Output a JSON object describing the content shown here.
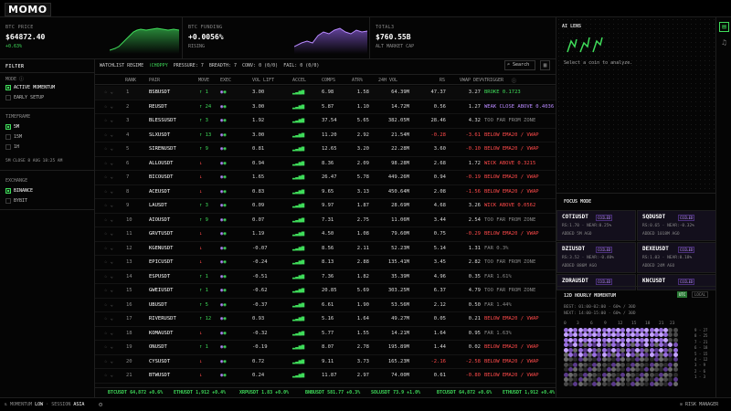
{
  "app": {
    "logo": "MOMO"
  },
  "metrics": [
    {
      "label": "BTC PRICE",
      "value": "$64872.40",
      "sub": "+0.63%",
      "sub_color": "g"
    },
    {
      "label": "BTC FUNDING",
      "value": "+0.0056%",
      "sub": "RISING",
      "sub_color": "m"
    },
    {
      "label": "TOTAL3",
      "value": "$760.55B",
      "sub": "ALT MARKET CAP",
      "sub_color": "m"
    }
  ],
  "sidebar": {
    "filter": "FILTER",
    "mode": "MODE",
    "mode_opts": [
      "ACTIVE MOMENTUM",
      "EARLY SETUP"
    ],
    "timeframe": "TIMEFRAME",
    "tf_opts": [
      "5M",
      "15M",
      "1H"
    ],
    "close_note": "5M CLOSE 8 AUG 18:25 AM",
    "exchange": "EXCHANGE",
    "ex_opts": [
      "BINANCE",
      "BYBIT"
    ]
  },
  "regime": {
    "label": "WATCHLIST REGIME",
    "value": "CHOPPY",
    "pressure": "PRESSURE: 7",
    "breadth": "BREADTH: 7",
    "conv": "CONV: 0 (0/0)",
    "fail": "FAIL: 0 (0/0)"
  },
  "search": {
    "label": "Search"
  },
  "columns": [
    "RANK",
    "PAIR",
    "MOVE",
    "EXEC",
    "VOL LIFT",
    "ACCEL",
    "COMPS",
    "ATR%",
    "24H VOL",
    "RS",
    "VWAP DEV%",
    "TRIGGER"
  ],
  "rows": [
    {
      "rank": "1",
      "pair": "BSBUSDT",
      "move": "↑ 1",
      "mc": "g",
      "lift": "3.00",
      "comps": "6.98",
      "atr": "1.58",
      "vol": "64.39M",
      "rs": "47.37",
      "rsc": "",
      "vw": "3.27",
      "vwc": "",
      "trig": "BROKE 0.1723",
      "tc": "g"
    },
    {
      "rank": "2",
      "pair": "REUSDT",
      "move": "↑ 24",
      "mc": "g",
      "lift": "3.00",
      "comps": "5.87",
      "atr": "1.10",
      "vol": "14.72M",
      "rs": "0.56",
      "rsc": "",
      "vw": "1.27",
      "vwc": "",
      "trig": "WEAK CLOSE ABOVE 0.4036",
      "tc": "p"
    },
    {
      "rank": "3",
      "pair": "BLESSUSDT",
      "move": "↑ 3",
      "mc": "g",
      "lift": "1.92",
      "comps": "37.54",
      "atr": "5.65",
      "vol": "382.05M",
      "rs": "28.46",
      "rsc": "",
      "vw": "4.32",
      "vwc": "",
      "trig": "TOO FAR FROM ZONE",
      "tc": "m"
    },
    {
      "rank": "4",
      "pair": "SLXUSDT",
      "move": "↑ 13",
      "mc": "g",
      "lift": "3.00",
      "comps": "11.20",
      "atr": "2.92",
      "vol": "21.54M",
      "rs": "-0.28",
      "rsc": "r",
      "vw": "-3.61",
      "vwc": "r",
      "trig": "BELOW EMA20 / VWAP",
      "tc": "r"
    },
    {
      "rank": "5",
      "pair": "SIRENUSDT",
      "move": "↑ 9",
      "mc": "g",
      "lift": "0.81",
      "comps": "12.65",
      "atr": "3.20",
      "vol": "22.28M",
      "rs": "3.60",
      "rsc": "",
      "vw": "-0.10",
      "vwc": "r",
      "trig": "BELOW EMA20 / VWAP",
      "tc": "r"
    },
    {
      "rank": "6",
      "pair": "ALLOUSDT",
      "move": "↓",
      "mc": "r",
      "lift": "0.94",
      "comps": "8.36",
      "atr": "2.09",
      "vol": "98.28M",
      "rs": "2.68",
      "rsc": "",
      "vw": "1.72",
      "vwc": "",
      "trig": "WICK ABOVE 0.3215",
      "tc": "r"
    },
    {
      "rank": "7",
      "pair": "BICOUSDT",
      "move": "↓",
      "mc": "r",
      "lift": "1.65",
      "comps": "26.47",
      "atr": "5.78",
      "vol": "449.26M",
      "rs": "0.94",
      "rsc": "",
      "vw": "-0.19",
      "vwc": "r",
      "trig": "BELOW EMA20 / VWAP",
      "tc": "r"
    },
    {
      "rank": "8",
      "pair": "ACEUSDT",
      "move": "↓",
      "mc": "r",
      "lift": "0.83",
      "comps": "9.65",
      "atr": "3.13",
      "vol": "450.64M",
      "rs": "2.08",
      "rsc": "",
      "vw": "-1.56",
      "vwc": "r",
      "trig": "BELOW EMA20 / VWAP",
      "tc": "r"
    },
    {
      "rank": "9",
      "pair": "LAUSDT",
      "move": "↑ 3",
      "mc": "g",
      "lift": "0.09",
      "comps": "9.97",
      "atr": "1.87",
      "vol": "28.69M",
      "rs": "4.68",
      "rsc": "",
      "vw": "3.26",
      "vwc": "",
      "trig": "WICK ABOVE 0.0562",
      "tc": "r"
    },
    {
      "rank": "10",
      "pair": "AIOUSDT",
      "move": "↑ 9",
      "mc": "g",
      "lift": "0.07",
      "comps": "7.31",
      "atr": "2.75",
      "vol": "11.06M",
      "rs": "3.44",
      "rsc": "",
      "vw": "2.54",
      "vwc": "",
      "trig": "TOO FAR FROM ZONE",
      "tc": "m"
    },
    {
      "rank": "11",
      "pair": "GRVTUSDT",
      "move": "↓",
      "mc": "r",
      "lift": "1.19",
      "comps": "4.50",
      "atr": "1.08",
      "vol": "79.60M",
      "rs": "0.75",
      "rsc": "",
      "vw": "-0.29",
      "vwc": "r",
      "trig": "BELOW EMA20 / VWAP",
      "tc": "r"
    },
    {
      "rank": "12",
      "pair": "KGENUSDT",
      "move": "↓",
      "mc": "r",
      "lift": "-0.07",
      "comps": "8.56",
      "atr": "2.11",
      "vol": "52.23M",
      "rs": "5.14",
      "rsc": "",
      "vw": "1.31",
      "vwc": "",
      "trig": "FAR 0.3%",
      "tc": "m"
    },
    {
      "rank": "13",
      "pair": "EPICUSDT",
      "move": "↓",
      "mc": "r",
      "lift": "-0.24",
      "comps": "8.13",
      "atr": "2.88",
      "vol": "135.41M",
      "rs": "3.45",
      "rsc": "",
      "vw": "2.82",
      "vwc": "",
      "trig": "TOO FAR FROM ZONE",
      "tc": "m"
    },
    {
      "rank": "14",
      "pair": "ESPUSDT",
      "move": "↑ 1",
      "mc": "g",
      "lift": "-0.51",
      "comps": "7.36",
      "atr": "1.82",
      "vol": "35.39M",
      "rs": "4.96",
      "rsc": "",
      "vw": "0.35",
      "vwc": "",
      "trig": "FAR 1.61%",
      "tc": "m"
    },
    {
      "rank": "15",
      "pair": "GWEIUSDT",
      "move": "↑ 1",
      "mc": "g",
      "lift": "-0.62",
      "comps": "20.85",
      "atr": "5.69",
      "vol": "303.25M",
      "rs": "6.37",
      "rsc": "",
      "vw": "4.79",
      "vwc": "",
      "trig": "TOO FAR FROM ZONE",
      "tc": "m"
    },
    {
      "rank": "16",
      "pair": "UBUSDT",
      "move": "↑ 5",
      "mc": "g",
      "lift": "-0.37",
      "comps": "6.61",
      "atr": "1.90",
      "vol": "53.56M",
      "rs": "2.12",
      "rsc": "",
      "vw": "0.50",
      "vwc": "",
      "trig": "FAR 1.44%",
      "tc": "m"
    },
    {
      "rank": "17",
      "pair": "RIVERUSDT",
      "move": "↑ 12",
      "mc": "g",
      "lift": "0.93",
      "comps": "5.16",
      "atr": "1.64",
      "vol": "49.27M",
      "rs": "0.05",
      "rsc": "",
      "vw": "0.21",
      "vwc": "",
      "trig": "BELOW EMA20 / VWAP",
      "tc": "r"
    },
    {
      "rank": "18",
      "pair": "KOMAUSDT",
      "move": "↓",
      "mc": "r",
      "lift": "-0.32",
      "comps": "5.77",
      "atr": "1.55",
      "vol": "14.21M",
      "rs": "1.64",
      "rsc": "",
      "vw": "0.95",
      "vwc": "",
      "trig": "FAR 1.63%",
      "tc": "m"
    },
    {
      "rank": "19",
      "pair": "ONUSDT",
      "move": "↑ 1",
      "mc": "g",
      "lift": "-0.19",
      "comps": "8.07",
      "atr": "2.78",
      "vol": "195.89M",
      "rs": "1.44",
      "rsc": "",
      "vw": "0.02",
      "vwc": "",
      "trig": "BELOW EMA20 / VWAP",
      "tc": "r"
    },
    {
      "rank": "20",
      "pair": "CYSUSDT",
      "move": "↓",
      "mc": "r",
      "lift": "0.72",
      "comps": "9.11",
      "atr": "3.73",
      "vol": "165.23M",
      "rs": "-2.16",
      "rsc": "r",
      "vw": "-2.58",
      "vwc": "r",
      "trig": "BELOW EMA20 / VWAP",
      "tc": "r"
    },
    {
      "rank": "21",
      "pair": "BTWUSDT",
      "move": "↓",
      "mc": "r",
      "lift": "0.24",
      "comps": "11.87",
      "atr": "2.97",
      "vol": "74.00M",
      "rs": "0.61",
      "rsc": "",
      "vw": "-0.80",
      "vwc": "r",
      "trig": "BELOW EMA20 / VWAP",
      "tc": "r"
    }
  ],
  "ticker": [
    "BTCUSDT 64,872 +0.6%",
    "ETHUSDT 1,912 +0.4%",
    "XRPUSDT 1.83 +0.0%",
    "BNBUSDT 581.77 +0.3%",
    "SOLUSDT 73.9 +1.0%",
    "BTCUSDT 64,872 +0.6%",
    "ETHUSDT 1,912 +0.4%"
  ],
  "bottom": {
    "momentum": "MOMENTUM",
    "level": "LOW",
    "session_label": "SESSION",
    "session": "ASIA",
    "risk": "RISK MANAGER"
  },
  "ai": {
    "title": "AI LENS",
    "prompt": "Select a coin to analyze."
  },
  "focus": {
    "title": "FOCUS MODE",
    "cards": [
      {
        "sym": "COTIUSDT",
        "badge": "COILED",
        "l1": "RS:1.70 · NEAR:0.25%",
        "l2": "ADDED 5M AGO"
      },
      {
        "sym": "SQDUSDT",
        "badge": "COILED",
        "l1": "RS:0.65 · NEAR:-0.32%",
        "l2": "ADDED 1018M AGO"
      },
      {
        "sym": "DZIUSDT",
        "badge": "COILED",
        "l1": "RS:3.52 · NEAR:-0.40%",
        "l2": "ADDED 886M AGO"
      },
      {
        "sym": "DEXEUSDT",
        "badge": "COILED",
        "l1": "RS:1.03 · NEAR:0.18%",
        "l2": "ADDED 24M AGO"
      },
      {
        "sym": "ZORAUSDT",
        "badge": "COILED",
        "l1": "",
        "l2": ""
      },
      {
        "sym": "KNCUSDT",
        "badge": "COILED",
        "l1": "",
        "l2": ""
      }
    ]
  },
  "hourly": {
    "title": "12D HOURLY MOMENTUM",
    "toggle_a": "UTC",
    "toggle_b": "LOCAL",
    "best": "BEST: 01:00-02:00 · 60% / 30D",
    "next": "NEXT: 14:00-15:00 · 60% / 30D",
    "cols": [
      "0",
      "3",
      "6",
      "9",
      "12",
      "15",
      "18",
      "21",
      "23"
    ],
    "legend": [
      "9 - 27",
      "8 - 25",
      "7 - 21",
      "6 - 18",
      "5 - 15",
      "4 - 12",
      "3 - 9",
      "2 - 6",
      "1 - 3"
    ]
  }
}
